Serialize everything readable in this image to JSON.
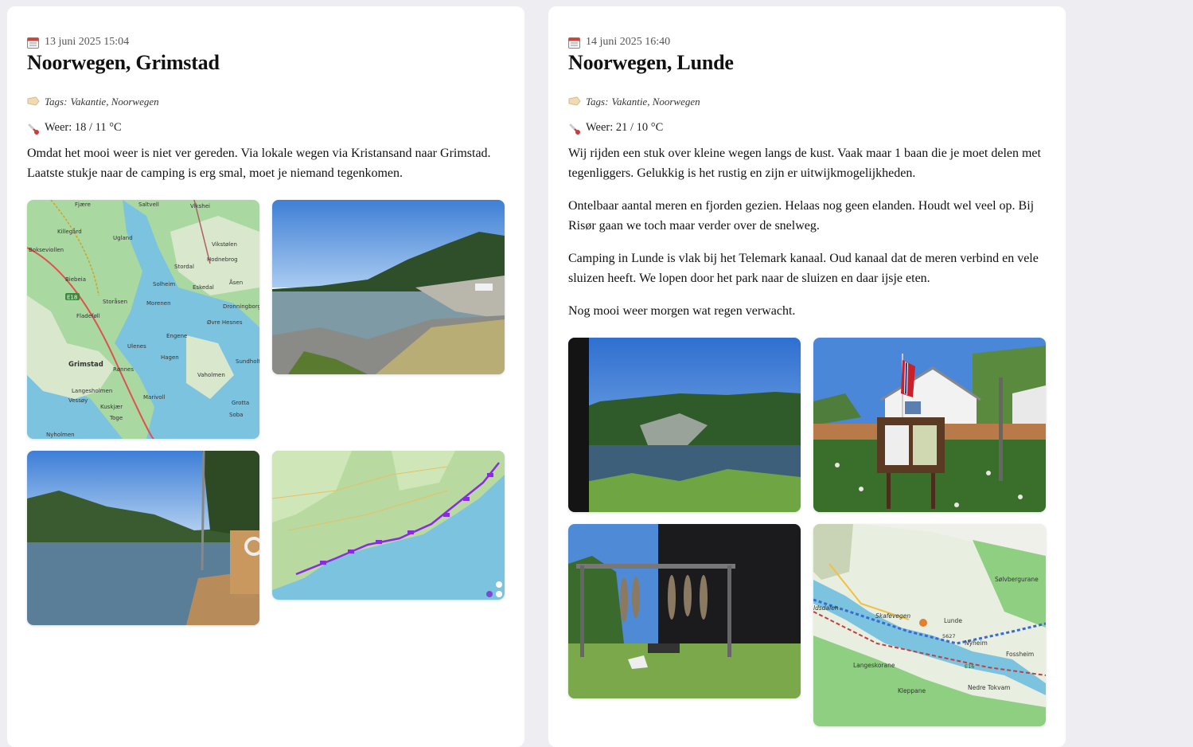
{
  "posts": [
    {
      "date": "13 juni 2025 15:04",
      "title": "Noorwegen, Grimstad",
      "tags_prefix": "Tags:",
      "tags": [
        "Vakantie",
        "Noorwegen"
      ],
      "weather_label": "Weer: 18 / 11 °C",
      "paragraphs": [
        "Omdat het mooi weer is niet ver gereden. Via lokale wegen via Kristansand naar Grimstad. Laatste stukje naar de camping is erg smal, moet je niemand tegenkomen."
      ],
      "map1_labels": [
        "Fjære",
        "Saltvell",
        "Vikshei",
        "Killegård",
        "Ugland",
        "Vikstølen",
        "Bokseviollen",
        "Hodnebrog",
        "Stordal",
        "Biebeia",
        "Solheim",
        "Eskedal",
        "Åsen",
        "Storåsen",
        "Morenen",
        "Dronningborg",
        "Fladeføll",
        "Øvre Hesnes",
        "Engene",
        "Ulenes",
        "Hagen",
        "Grimstad",
        "Sundholt",
        "Rønnes",
        "Vaholmen",
        "Langesholmen",
        "Marivoll",
        "Vessøy",
        "Kuskjær",
        "Grotta",
        "Toge",
        "Soba",
        "Nyholmen",
        "E18"
      ],
      "images": [
        {
          "icon": "map-grimstad-photo"
        },
        {
          "icon": "lake-coast-photo"
        },
        {
          "icon": "harbor-dock-photo"
        },
        {
          "icon": "route-map-photo"
        }
      ]
    },
    {
      "date": "14 juni 2025 16:40",
      "title": "Noorwegen, Lunde",
      "tags_prefix": "Tags:",
      "tags": [
        "Vakantie",
        "Noorwegen"
      ],
      "weather_label": "Weer: 21 / 10 °C",
      "paragraphs": [
        "Wij rijden een stuk over kleine wegen langs de kust. Vaak maar 1 baan die je moet delen met tegenliggers. Gelukkig is het rustig en zijn er uitwijkmogelijkheden.",
        "Ontelbaar aantal meren en fjorden gezien. Helaas nog geen elanden. Houdt wel veel op. Bij Risør gaan we toch maar verder over de snelweg.",
        "Camping in Lunde is vlak bij het Telemark kanaal. Oud kanaal dat de meren verbind en vele sluizen heeft. We lopen door het park naar de sluizen en daar ijsje eten.",
        "Nog mooi weer morgen wat regen verwacht."
      ],
      "map2_labels": [
        "Sølvbergurane",
        "Lunde",
        "Skafevegen",
        "Nyheim",
        "Fossheim",
        "Langeskorane",
        "Kleppane",
        "Nedre Tokvam",
        "5627",
        "E16",
        "ldsdalen"
      ],
      "images": [
        {
          "icon": "forest-lake-photo"
        },
        {
          "icon": "flag-house-photo"
        },
        {
          "icon": "fish-drying-photo"
        },
        {
          "icon": "map-lunde-photo"
        }
      ]
    }
  ],
  "colors": {
    "page_bg": "#eeeef2",
    "card_bg": "#ffffff",
    "map_water": "#7cc3e0",
    "map_land": "#8fcf82",
    "route": "#8a2be2"
  }
}
